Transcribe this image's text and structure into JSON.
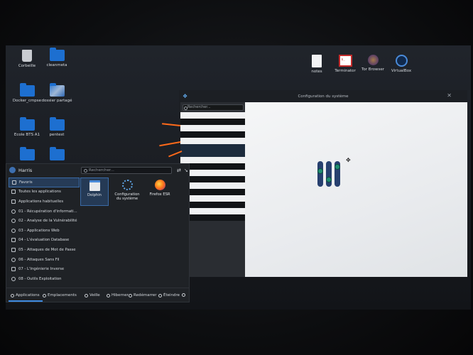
{
  "desktop": {
    "icons": [
      {
        "label": "Corbeille",
        "icon": "trash-icon"
      },
      {
        "label": "cleanmeta",
        "icon": "folder-icon"
      },
      {
        "label": "Docker_cmpse",
        "icon": "folder-icon"
      },
      {
        "label": "dossier partagé",
        "icon": "folder-icon"
      },
      {
        "label": "Ecole BTS A1",
        "icon": "folder-icon"
      },
      {
        "label": "pentest",
        "icon": "folder-icon"
      },
      {
        "label": "notes",
        "icon": "document-icon"
      },
      {
        "label": "Terminator",
        "icon": "terminal-icon"
      },
      {
        "label": "Tor Browser",
        "icon": "tor-browser-icon"
      },
      {
        "label": "VirtualBox",
        "icon": "virtualbox-icon"
      }
    ]
  },
  "settings_window": {
    "title": "Configuration du système",
    "search_placeholder": "Rechercher..."
  },
  "start_menu": {
    "user_name": "Harris",
    "search_placeholder": "Rechercher...",
    "categories": [
      {
        "label": "Favoris",
        "icon": "bookmark-icon"
      },
      {
        "label": "Toutes les applications",
        "icon": "grid-icon"
      },
      {
        "label": "Applications habituelles",
        "icon": "apps-icon"
      },
      {
        "label": "01 - Récupération d'informati...",
        "icon": "search-icon"
      },
      {
        "label": "02 - Analyse de la Vulnérabilité",
        "icon": "scan-icon"
      },
      {
        "label": "03 - Applications Web",
        "icon": "web-icon"
      },
      {
        "label": "04 - L'évaluation Database",
        "icon": "database-icon"
      },
      {
        "label": "05 - Attaques de Mot de Passe",
        "icon": "key-icon"
      },
      {
        "label": "06 - Attaques Sans Fil",
        "icon": "wifi-icon"
      },
      {
        "label": "07 - L'Ingénierie Inverse",
        "icon": "reverse-icon"
      },
      {
        "label": "08 - Outils Exploitation",
        "icon": "exploit-icon"
      }
    ],
    "favorites": [
      {
        "label": "Dolphin",
        "icon": "dolphin-icon"
      },
      {
        "label": "Configuration du système",
        "icon": "system-settings-icon"
      },
      {
        "label": "Firefox ESR",
        "icon": "firefox-icon"
      }
    ],
    "footer": {
      "applications": "Applications",
      "places": "Emplacements",
      "sleep": "Veille",
      "hibernate": "Hiberner",
      "restart": "Redémarrer",
      "shutdown": "Éteindre"
    }
  }
}
